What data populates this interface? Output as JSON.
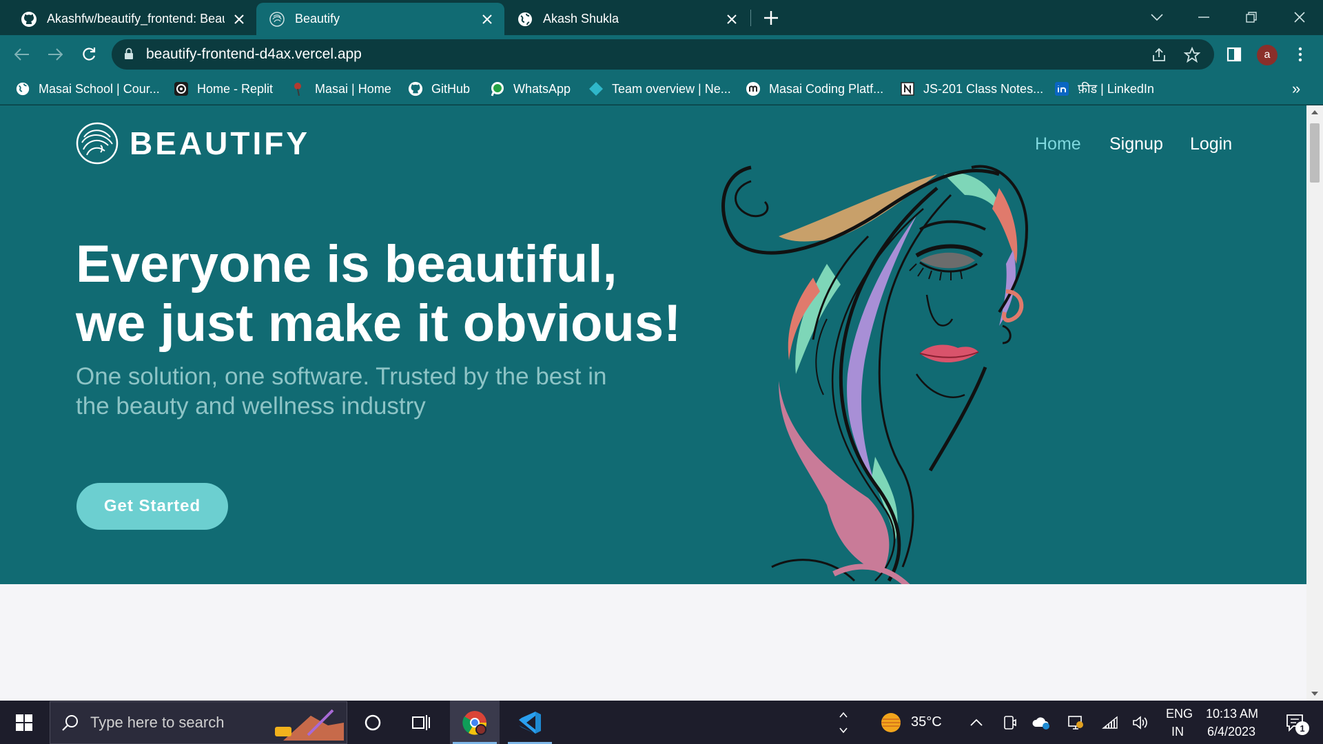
{
  "browser": {
    "tabs": [
      {
        "title": "Akashfw/beautify_frontend: Beau",
        "icon": "github-icon",
        "active": false
      },
      {
        "title": "Beautify",
        "icon": "beautify-logo-icon",
        "active": true
      },
      {
        "title": "Akash Shukla",
        "icon": "globe-icon",
        "active": false
      }
    ],
    "url": "beautify-frontend-d4ax.vercel.app",
    "profile_initial": "a",
    "bookmarks": [
      {
        "label": "Masai School | Cour...",
        "icon": "globe-icon"
      },
      {
        "label": "Home - Replit",
        "icon": "replit-icon"
      },
      {
        "label": "Masai | Home",
        "icon": "masai-icon"
      },
      {
        "label": "GitHub",
        "icon": "github-icon"
      },
      {
        "label": "WhatsApp",
        "icon": "whatsapp-icon"
      },
      {
        "label": "Team overview | Ne...",
        "icon": "diamond-icon"
      },
      {
        "label": "Masai Coding Platf...",
        "icon": "masai-m-icon"
      },
      {
        "label": "JS-201 Class Notes...",
        "icon": "notion-icon"
      },
      {
        "label": "फ़ीड | LinkedIn",
        "icon": "linkedin-icon"
      }
    ],
    "bookmarks_overflow": "»"
  },
  "site": {
    "brand": "BEAUTIFY",
    "nav": [
      {
        "label": "Home",
        "active": true
      },
      {
        "label": "Signup",
        "active": false
      },
      {
        "label": "Login",
        "active": false
      }
    ],
    "headline_line1": "Everyone is beautiful,",
    "headline_line2": "we just make it obvious!",
    "subheadline": "One solution, one software. Trusted by the best in the beauty and wellness industry",
    "cta": "Get Started",
    "colors": {
      "hero_bg": "#116b73",
      "cta_bg": "#6ccfd0",
      "nav_active": "#7fd8de",
      "subhead": "#8ec4c6"
    }
  },
  "taskbar": {
    "search_placeholder": "Type here to search",
    "weather": "35°C",
    "language": "ENG",
    "region": "IN",
    "time": "10:13 AM",
    "date": "6/4/2023",
    "notification_count": "1"
  }
}
